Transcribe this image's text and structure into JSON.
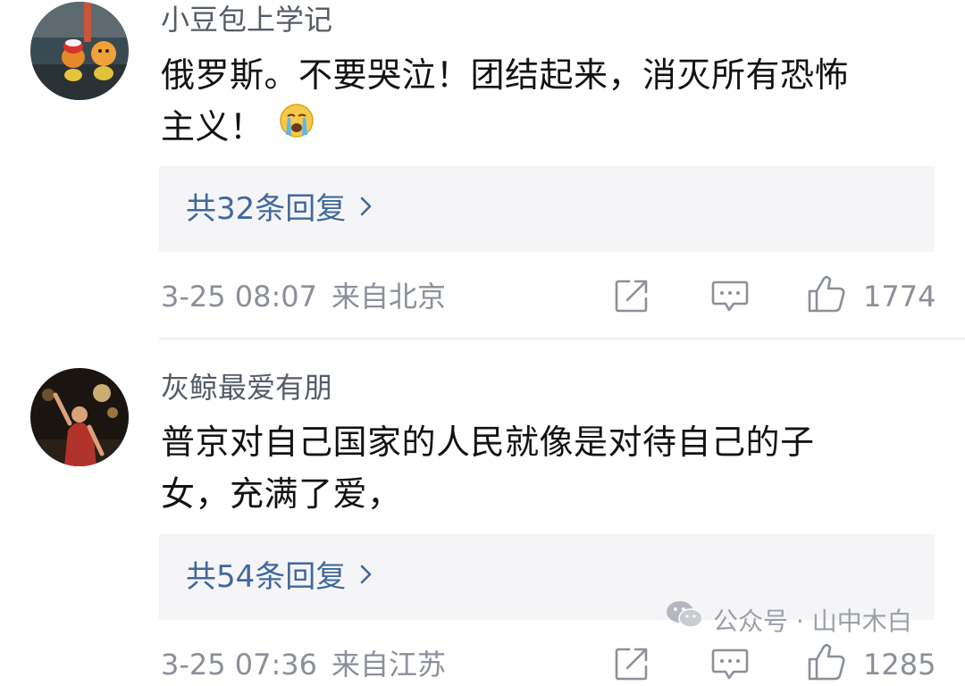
{
  "comments": [
    {
      "avatar": "avatar-garfield-toys",
      "username": "小豆包上学记",
      "content_lines": [
        "俄罗斯。不要哭泣！团结起来，消灭所有恐怖",
        "主义！"
      ],
      "emoji": "crying-face",
      "reply_label": "共32条回复",
      "date": "3-25 08:07",
      "location": "来自北京",
      "likes": "1774"
    },
    {
      "avatar": "avatar-concert-performer",
      "username": "灰鲸最爱有朋",
      "content_lines": [
        "普京对自己国家的人民就像是对待自己的子",
        "女，充满了爱，"
      ],
      "reply_label": "共54条回复",
      "date": "3-25 07:36",
      "location": "来自江苏",
      "likes": "1285"
    }
  ],
  "icons": {
    "share": "share-icon",
    "comment": "comment-icon",
    "like": "thumbs-up-icon",
    "chevron": "chevron-right-icon",
    "wechat": "wechat-icon"
  },
  "watermark": {
    "text": "公众号 · 山中木白"
  },
  "colors": {
    "link": "#41689c",
    "meta": "#8a8f99",
    "reply_bg": "#f5f5f7"
  }
}
